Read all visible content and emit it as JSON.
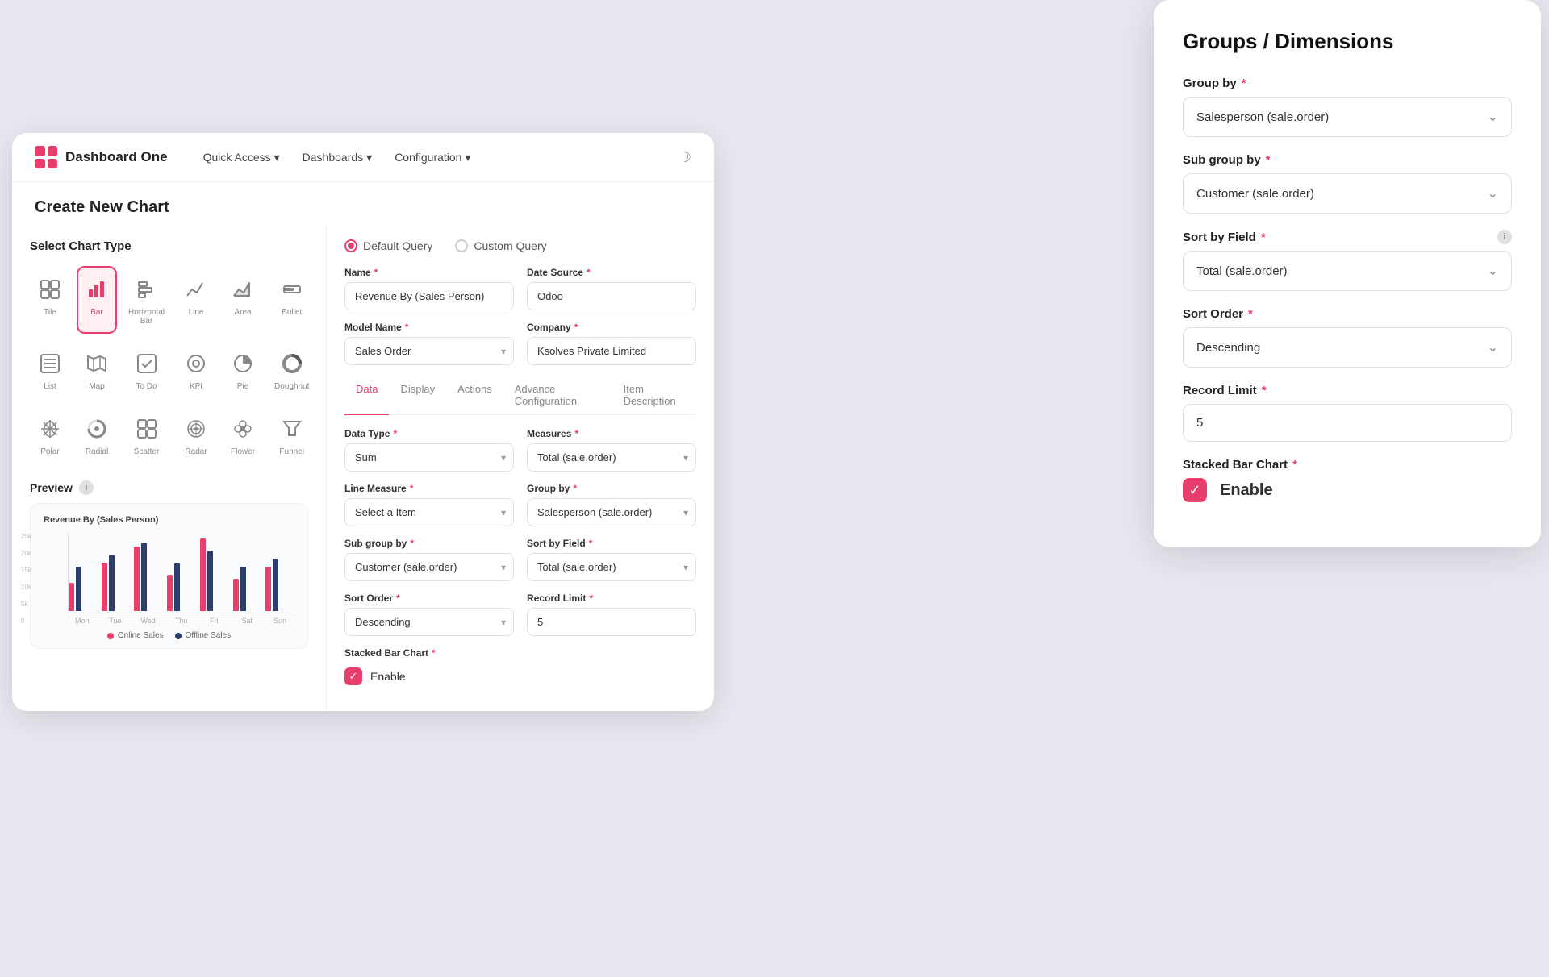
{
  "app": {
    "logo_label": "Dashboard One",
    "nav_links": [
      "Quick Access",
      "Dashboards",
      "Configuration"
    ],
    "page_title": "Create New Chart"
  },
  "chart_types": [
    {
      "id": "tile",
      "label": "Tile",
      "icon": "▦"
    },
    {
      "id": "bar",
      "label": "Bar",
      "icon": "📊",
      "selected": true
    },
    {
      "id": "hbar",
      "label": "Horizontal Bar",
      "icon": "≡"
    },
    {
      "id": "line",
      "label": "Line",
      "icon": "📈"
    },
    {
      "id": "area",
      "label": "Area",
      "icon": "∿"
    },
    {
      "id": "bullet",
      "label": "Bullet",
      "icon": "⊟"
    },
    {
      "id": "list",
      "label": "List",
      "icon": "☰"
    },
    {
      "id": "map",
      "label": "Map",
      "icon": "🗺"
    },
    {
      "id": "todo",
      "label": "To Do",
      "icon": "☑"
    },
    {
      "id": "kpi",
      "label": "KPI",
      "icon": "◎"
    },
    {
      "id": "pie",
      "label": "Pie",
      "icon": "◔"
    },
    {
      "id": "doughnut",
      "label": "Doughnut",
      "icon": "⊙"
    },
    {
      "id": "polar",
      "label": "Polar",
      "icon": "✳"
    },
    {
      "id": "radial",
      "label": "Radial",
      "icon": "◉"
    },
    {
      "id": "scatter",
      "label": "Scatter",
      "icon": "⊞"
    },
    {
      "id": "radar",
      "label": "Radar",
      "icon": "◈"
    },
    {
      "id": "flower",
      "label": "Flower",
      "icon": "✿"
    },
    {
      "id": "funnel",
      "label": "Funnel",
      "icon": "⋮"
    }
  ],
  "preview": {
    "title": "Preview",
    "chart_title": "Revenue By (Sales Person)",
    "y_labels": [
      "25k",
      "20k",
      "15k",
      "10k",
      "5k",
      "0"
    ],
    "x_labels": [
      "Mon",
      "Tue",
      "Wed",
      "Thu",
      "Fri",
      "Sat",
      "Sun"
    ],
    "legend": [
      {
        "label": "Online Sales",
        "color": "#e83e6c"
      },
      {
        "label": "Offline Sales",
        "color": "#2c3e6b"
      }
    ],
    "bar_data": [
      {
        "pink": 35,
        "dark": 55
      },
      {
        "pink": 60,
        "dark": 70
      },
      {
        "pink": 80,
        "dark": 85
      },
      {
        "pink": 45,
        "dark": 60
      },
      {
        "pink": 90,
        "dark": 75
      },
      {
        "pink": 40,
        "dark": 55
      },
      {
        "pink": 55,
        "dark": 65
      }
    ]
  },
  "query": {
    "default_label": "Default Query",
    "custom_label": "Custom Query"
  },
  "form": {
    "name_label": "Name",
    "name_value": "Revenue By (Sales Person)",
    "date_source_label": "Date Source",
    "date_source_value": "Odoo",
    "model_name_label": "Model Name",
    "model_name_value": "Sales Order",
    "company_label": "Company",
    "company_value": "Ksolves Private Limited"
  },
  "tabs": [
    "Data",
    "Display",
    "Actions",
    "Advance Configuration",
    "Item Description"
  ],
  "data_tab": {
    "data_type_label": "Data Type",
    "data_type_value": "Sum",
    "measures_label": "Measures",
    "measures_value": "Total (sale.order)",
    "line_measure_label": "Line Measure",
    "line_measure_value": "Select a Item",
    "group_by_label": "Group by",
    "group_by_value": "Salesperson (sale.order)",
    "sub_group_by_label": "Sub group by",
    "sub_group_by_value": "Customer (sale.order)",
    "sort_by_field_label": "Sort by Field",
    "sort_by_field_value": "Total  (sale.order)",
    "sort_order_label": "Sort Order",
    "sort_order_value": "Descending",
    "record_limit_label": "Record Limit",
    "record_limit_value": "5",
    "stacked_bar_label": "Stacked Bar Chart",
    "enable_label": "Enable"
  },
  "right_panel": {
    "title": "Groups / Dimensions",
    "group_by_label": "Group by",
    "group_by_value": "Salesperson (sale.order)",
    "sub_group_by_label": "Sub group by",
    "sub_group_by_value": "Customer (sale.order)",
    "sort_by_field_label": "Sort by Field",
    "sort_by_field_value": "Total  (sale.order)",
    "sort_order_label": "Sort Order",
    "sort_order_value": "Descending",
    "record_limit_label": "Record Limit",
    "record_limit_value": "5",
    "stacked_bar_label": "Stacked Bar Chart",
    "enable_label": "Enable",
    "required_star": "*"
  }
}
